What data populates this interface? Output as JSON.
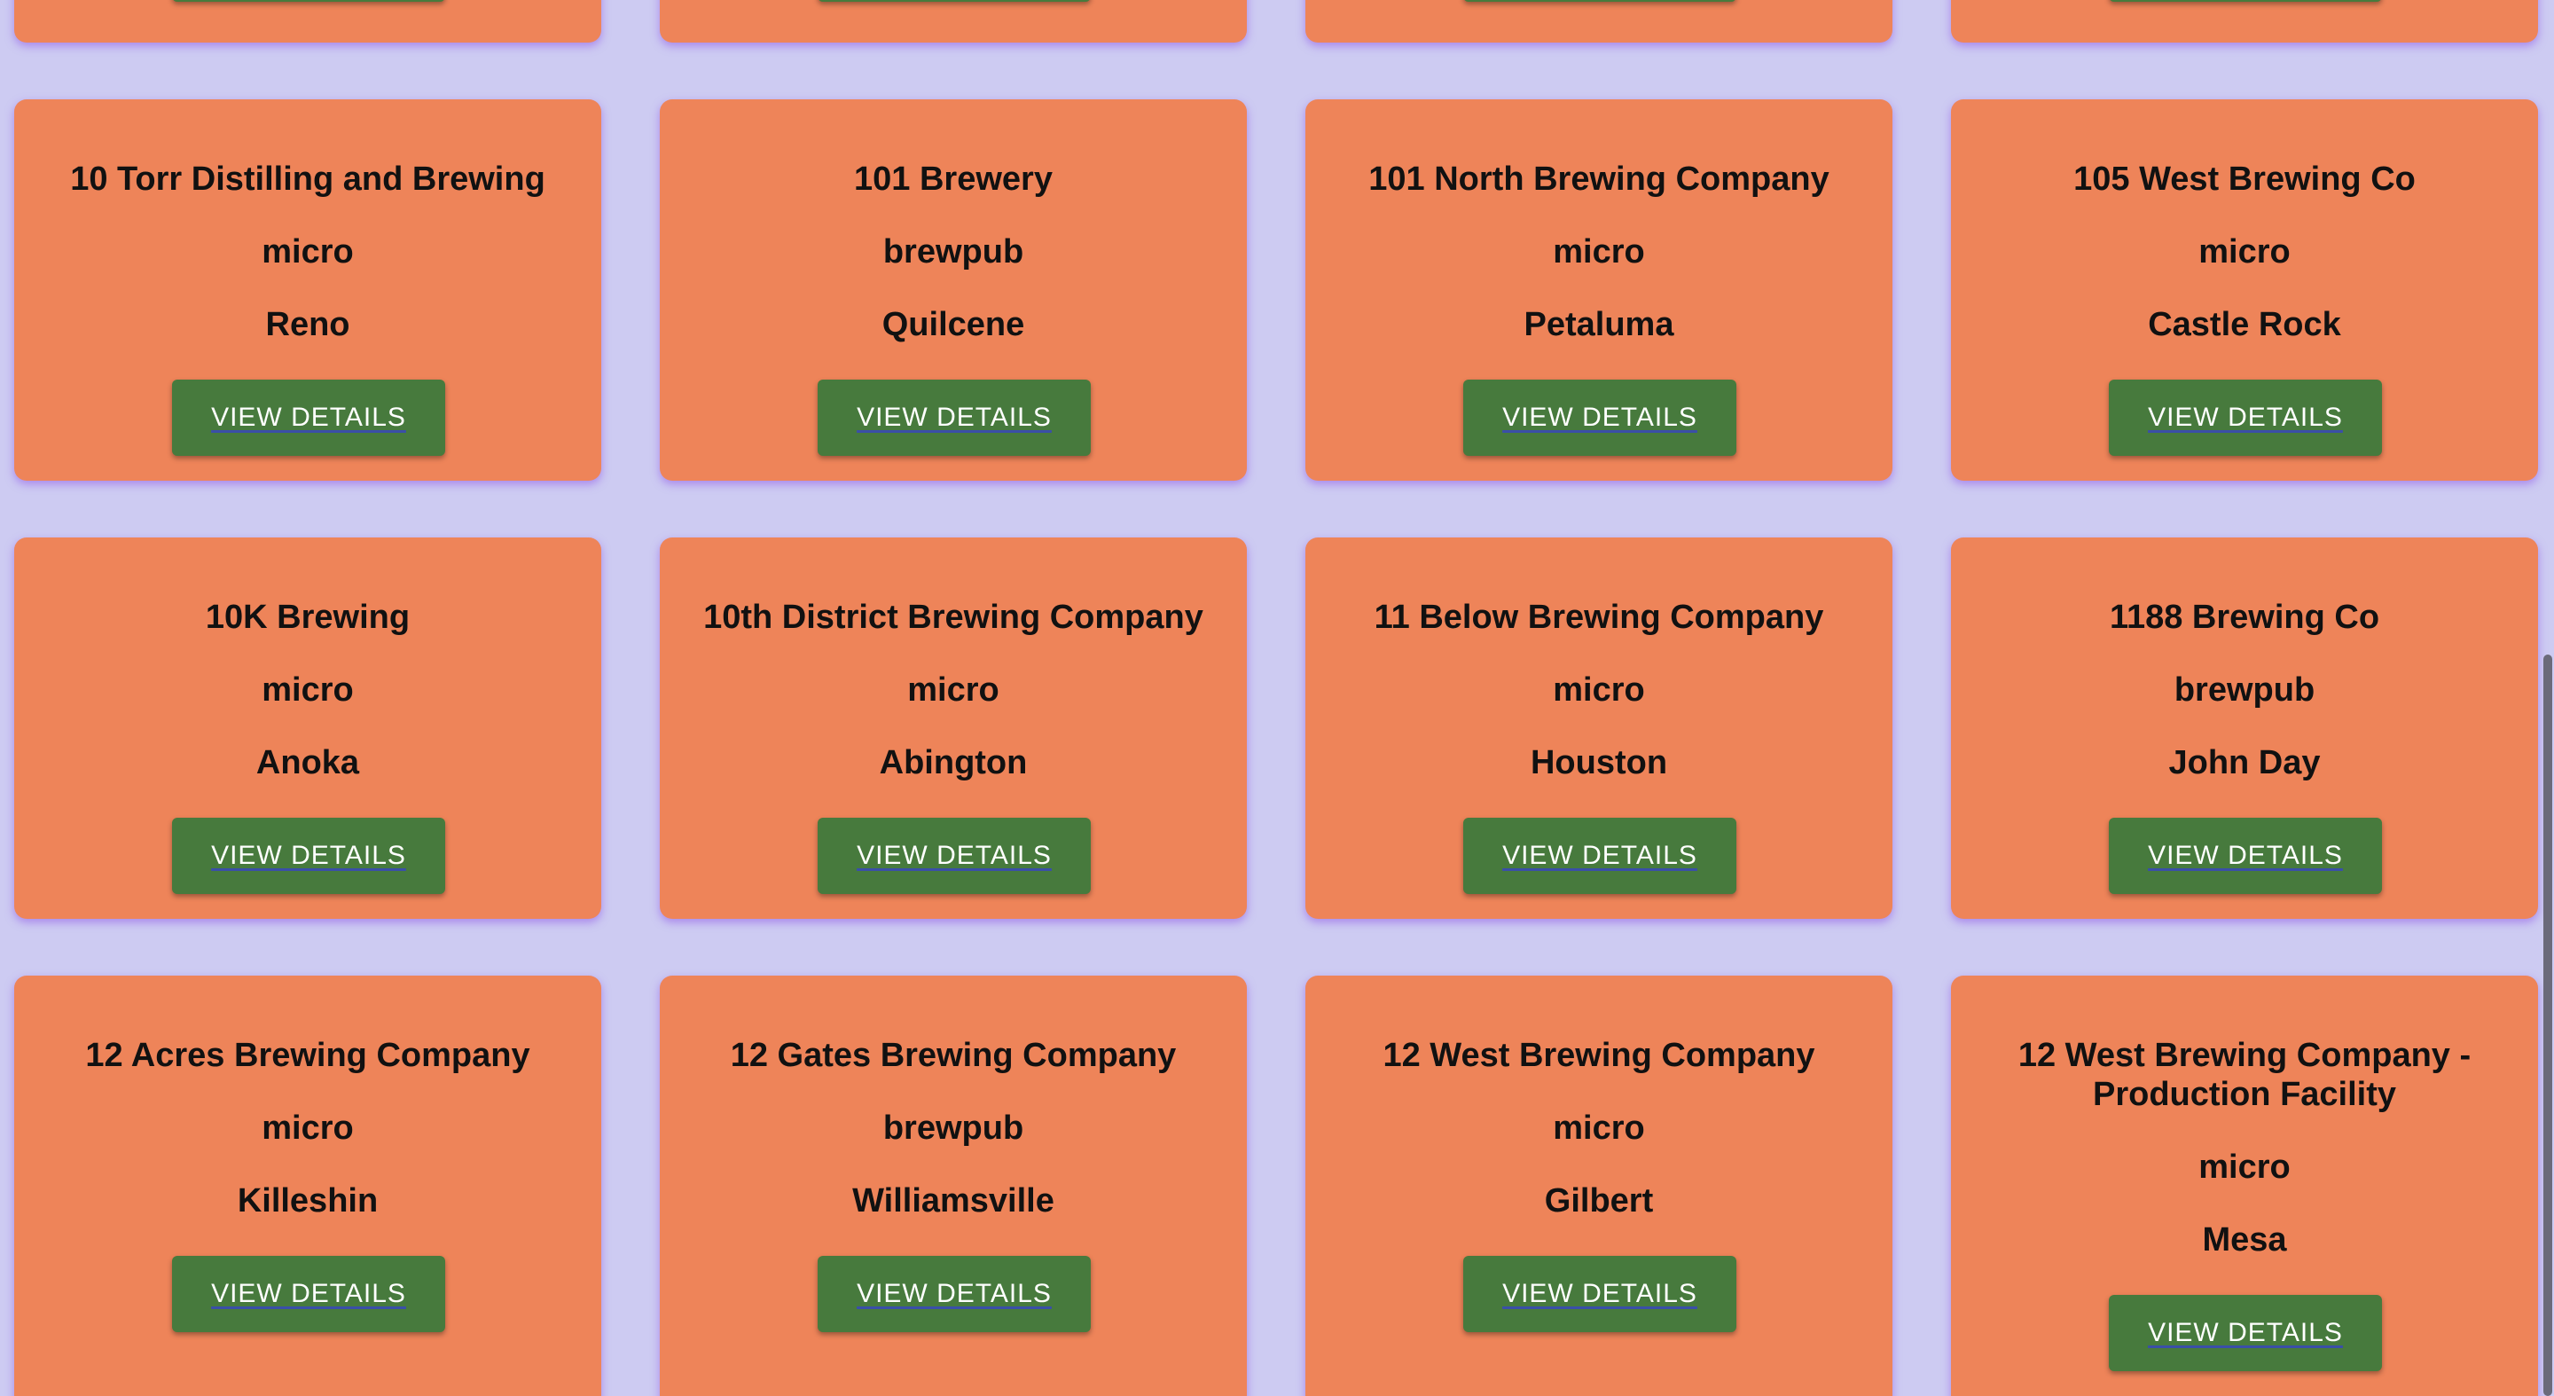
{
  "button_label": "VIEW DETAILS",
  "colors": {
    "background": "#cdcbf2",
    "card": "#ee8459",
    "button": "#477a3d",
    "button_text": "#ffffff"
  },
  "rows": [
    [
      {
        "name": "",
        "type": "",
        "city": ""
      },
      {
        "name": "",
        "type": "",
        "city": ""
      },
      {
        "name": "",
        "type": "",
        "city": ""
      },
      {
        "name": "",
        "type": "",
        "city": ""
      }
    ],
    [
      {
        "name": "10 Torr Distilling and Brewing",
        "type": "micro",
        "city": "Reno"
      },
      {
        "name": "101 Brewery",
        "type": "brewpub",
        "city": "Quilcene"
      },
      {
        "name": "101 North Brewing Company",
        "type": "micro",
        "city": "Petaluma"
      },
      {
        "name": "105 West Brewing Co",
        "type": "micro",
        "city": "Castle Rock"
      }
    ],
    [
      {
        "name": "10K Brewing",
        "type": "micro",
        "city": "Anoka"
      },
      {
        "name": "10th District Brewing Company",
        "type": "micro",
        "city": "Abington"
      },
      {
        "name": "11 Below Brewing Company",
        "type": "micro",
        "city": "Houston"
      },
      {
        "name": "1188 Brewing Co",
        "type": "brewpub",
        "city": "John Day"
      }
    ],
    [
      {
        "name": "12 Acres Brewing Company",
        "type": "micro",
        "city": "Killeshin"
      },
      {
        "name": "12 Gates Brewing Company",
        "type": "brewpub",
        "city": "Williamsville"
      },
      {
        "name": "12 West Brewing Company",
        "type": "micro",
        "city": "Gilbert"
      },
      {
        "name": "12 West Brewing Company - Production Facility",
        "type": "micro",
        "city": "Mesa"
      }
    ]
  ]
}
